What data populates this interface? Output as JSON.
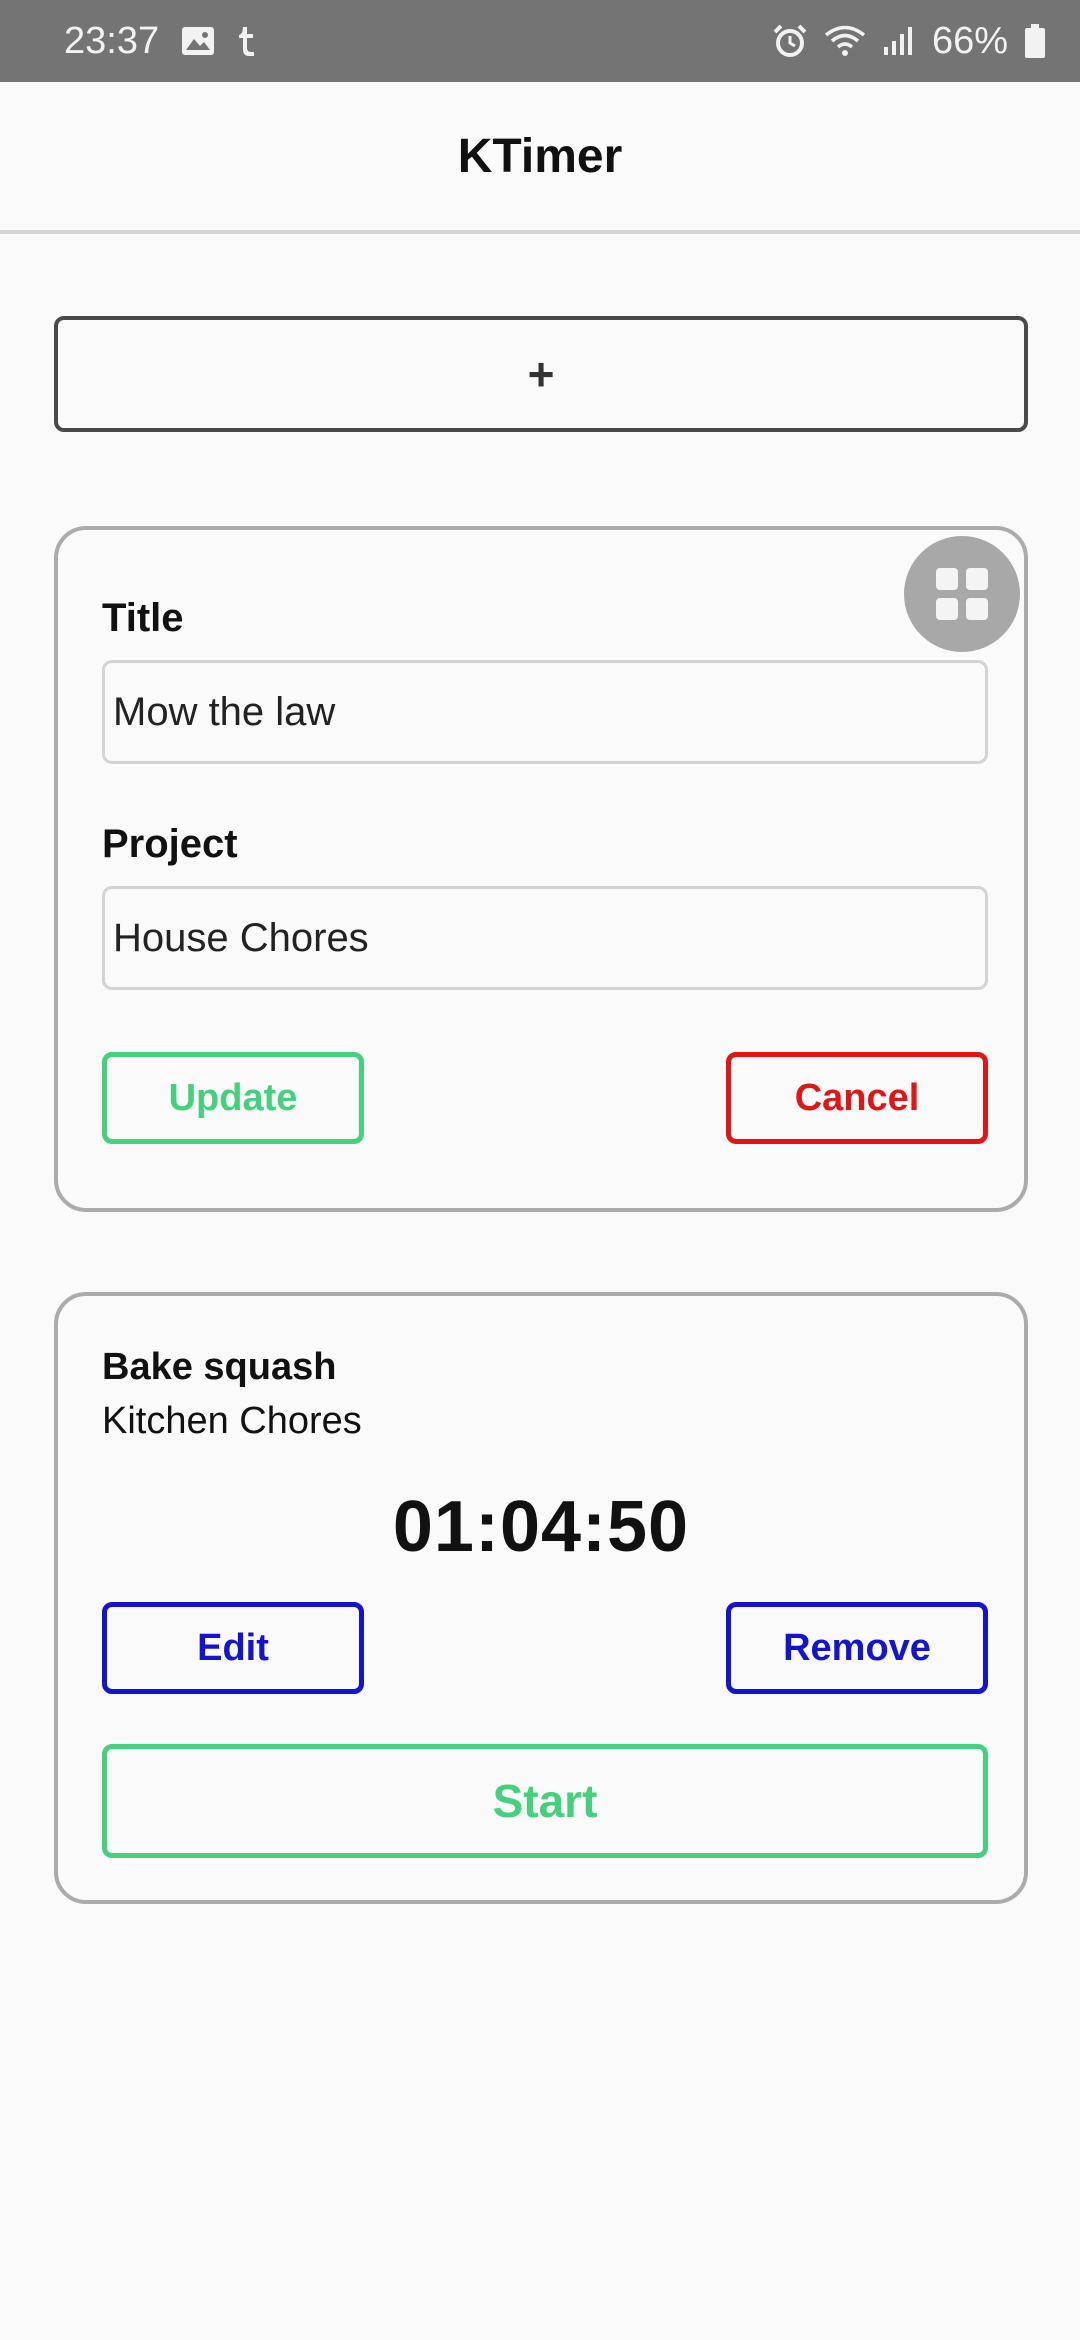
{
  "status_bar": {
    "time": "23:37",
    "left_icons": [
      "image-icon",
      "tumblr-icon"
    ],
    "right_icons": [
      "alarm-icon",
      "wifi-icon",
      "signal-icon"
    ],
    "battery": "66%"
  },
  "app_bar": {
    "title": "KTimer"
  },
  "add_button": {
    "label": "+"
  },
  "edit_card": {
    "title_label": "Title",
    "title_value": "Mow the law",
    "project_label": "Project",
    "project_value": "House Chores",
    "update_label": "Update",
    "cancel_label": "Cancel",
    "drag_icon": "grid-icon"
  },
  "timer_card": {
    "task_title": "Bake squash",
    "task_project": "Kitchen Chores",
    "elapsed": "01:04:50",
    "edit_label": "Edit",
    "remove_label": "Remove",
    "start_label": "Start"
  },
  "colors": {
    "accent_green": "#45d07e",
    "danger_red": "#e01616",
    "action_blue": "#1414cc",
    "status_bar": "#747474"
  }
}
